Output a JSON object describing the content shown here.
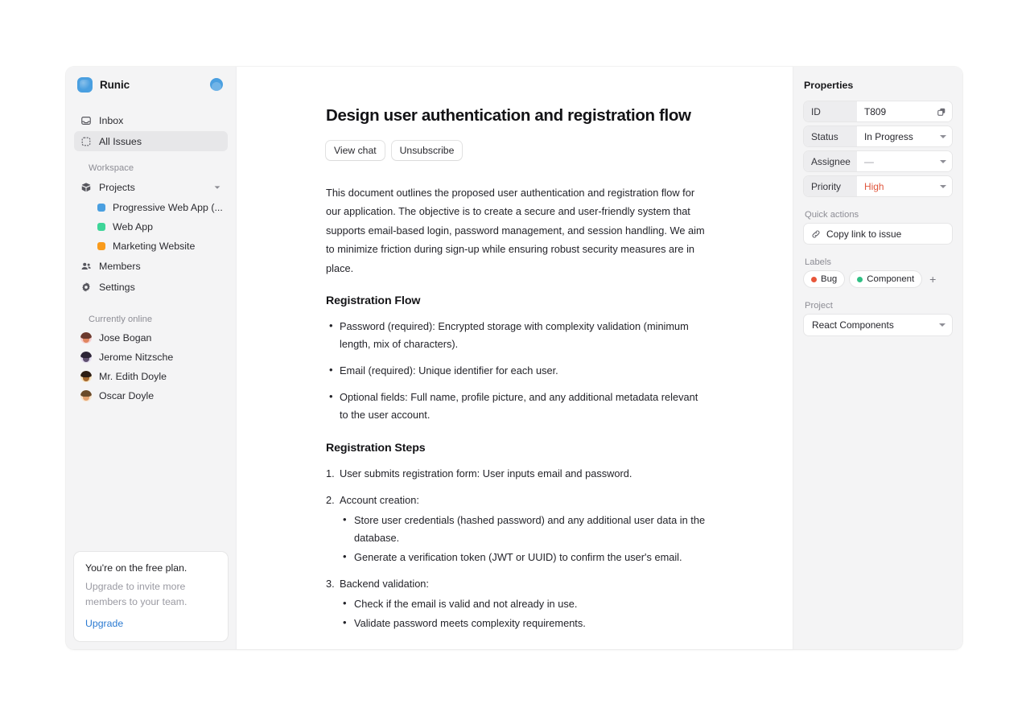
{
  "app": {
    "brand_name": "Runic",
    "logo_color": "#4a9fe0",
    "avatar_color": "#4a9fe0"
  },
  "sidebar": {
    "nav": [
      {
        "label": "Inbox",
        "icon": "inbox-icon",
        "active": false
      },
      {
        "label": "All Issues",
        "icon": "all-issues-icon",
        "active": true
      }
    ],
    "workspace_label": "Workspace",
    "projects_label": "Projects",
    "projects": [
      {
        "label": "Progressive Web App (...",
        "color": "#4a9fe0"
      },
      {
        "label": "Web App",
        "color": "#3ed598"
      },
      {
        "label": "Marketing Website",
        "color": "#f99b1c"
      }
    ],
    "members_label": "Members",
    "settings_label": "Settings",
    "online_label": "Currently online",
    "online": [
      {
        "name": "Jose Bogan",
        "bg": "#f6cfcf",
        "hair": "#6b3a2e",
        "face": "#e0855f"
      },
      {
        "name": "Jerome Nitzsche",
        "bg": "#e3dcef",
        "hair": "#2c2436",
        "face": "#5f5070"
      },
      {
        "name": "Mr. Edith Doyle",
        "bg": "#f7e2bd",
        "hair": "#2c1d14",
        "face": "#a3672e"
      },
      {
        "name": "Oscar Doyle",
        "bg": "#f9e4cd",
        "hair": "#6a4a2a",
        "face": "#e3a271"
      }
    ],
    "plan": {
      "title": "You're on the free plan.",
      "subtitle": "Upgrade to invite more members to your team.",
      "link": "Upgrade",
      "link_color": "#2b7ad1"
    }
  },
  "document": {
    "title": "Design user authentication and registration flow",
    "buttons": [
      {
        "label": "View chat"
      },
      {
        "label": "Unsubscribe"
      }
    ],
    "intro": "This document outlines the proposed user authentication and registration flow for our application. The objective is to create a secure and user-friendly system that supports email-based login, password management, and session handling. We aim to minimize friction during sign-up while ensuring robust security measures are in place.",
    "section_flow_heading": "Registration Flow",
    "flow_bullets": [
      "Password (required): Encrypted storage with complexity validation (minimum length, mix of characters).",
      "Email (required): Unique identifier for each user.",
      "Optional fields: Full name, profile picture, and any additional metadata relevant to the user account."
    ],
    "section_steps_heading": "Registration Steps",
    "steps": [
      {
        "text": "User submits registration form: User inputs email and password.",
        "sub": []
      },
      {
        "text": "Account creation:",
        "sub": [
          "Store user credentials (hashed password) and any additional user data in the database.",
          "Generate a verification token (JWT or UUID) to confirm the user's email."
        ]
      },
      {
        "text": "Backend validation:",
        "sub": [
          "Check if the email is valid and not already in use.",
          "Validate password meets complexity requirements."
        ]
      }
    ]
  },
  "properties": {
    "title": "Properties",
    "rows": [
      {
        "key": "ID",
        "value": "T809",
        "control": "copy"
      },
      {
        "key": "Status",
        "value": "In Progress",
        "control": "dropdown"
      },
      {
        "key": "Assignee",
        "value": "—",
        "control": "dropdown",
        "muted": true
      },
      {
        "key": "Priority",
        "value": "High",
        "control": "dropdown",
        "accent": "#e0563d"
      }
    ],
    "quick_actions_label": "Quick actions",
    "copy_link_label": "Copy link to issue",
    "labels_label": "Labels",
    "labels": [
      {
        "name": "Bug",
        "color": "#e8563a"
      },
      {
        "name": "Component",
        "color": "#2fbf84"
      }
    ],
    "add_label": "+",
    "project_label": "Project",
    "project_value": "React Components"
  }
}
